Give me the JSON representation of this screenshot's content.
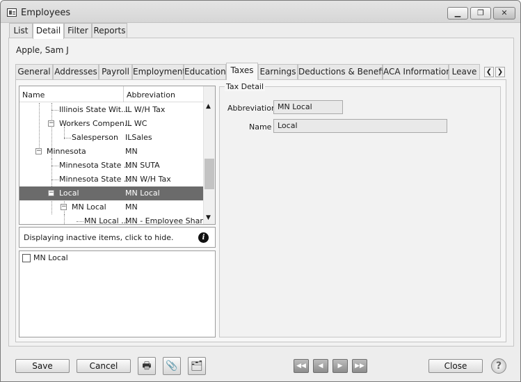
{
  "window": {
    "title": "Employees",
    "minimize_glyph": "▁",
    "maximize_glyph": "❐",
    "close_glyph": "✕"
  },
  "top_tabs": [
    "List",
    "Detail",
    "Filter",
    "Reports"
  ],
  "employee_name": "Apple, Sam J",
  "sub_tabs": [
    "General",
    "Addresses",
    "Payroll",
    "Employment",
    "Education",
    "Taxes",
    "Earnings",
    "Deductions & Benefits",
    "ACA Information",
    "Leave"
  ],
  "sub_tabs_active": "Taxes",
  "tree": {
    "columns": {
      "name": "Name",
      "abbreviation": "Abbreviation"
    },
    "rows": [
      {
        "label": "Illinois State Wit...",
        "abbr": "IL W/H Tax"
      },
      {
        "label": "Workers Compen...",
        "abbr": "IL WC"
      },
      {
        "label": "Salesperson",
        "abbr": "ILSales"
      },
      {
        "label": "Minnesota",
        "abbr": "MN"
      },
      {
        "label": "Minnesota State ...",
        "abbr": "MN SUTA"
      },
      {
        "label": "Minnesota State ...",
        "abbr": "MN W/H Tax"
      },
      {
        "label": "Local",
        "abbr": "MN Local",
        "selected": true
      },
      {
        "label": "MN Local",
        "abbr": "MN"
      },
      {
        "label": "MN Local ...",
        "abbr": "MN - Employee Share"
      }
    ],
    "expander_glyph": "−"
  },
  "info_bar": {
    "text": "Displaying inactive items, click to hide.",
    "icon": "info-icon",
    "glyph": "i"
  },
  "detail_list": {
    "items": [
      {
        "label": "MN Local",
        "checked": false
      }
    ]
  },
  "tax_detail": {
    "legend": "Tax Detail",
    "abbreviation_label": "Abbreviation",
    "abbreviation_value": "MN Local",
    "name_label": "Name",
    "name_value": "Local"
  },
  "buttons": {
    "save": "Save",
    "cancel": "Cancel",
    "close": "Close",
    "help": "?"
  },
  "toolbar_icons": [
    "printer-icon",
    "paperclip-icon",
    "notes-icon"
  ],
  "toolbar_glyphs": {
    "print": "🖶",
    "attach": "📎",
    "notes": "🗂"
  },
  "nav_glyphs": {
    "first": "◀◀",
    "prev": "◀",
    "next": "▶",
    "last": "▶▶"
  },
  "scroll_glyphs": {
    "left": "❮",
    "right": "❯",
    "up": "▲",
    "down": "▼"
  }
}
